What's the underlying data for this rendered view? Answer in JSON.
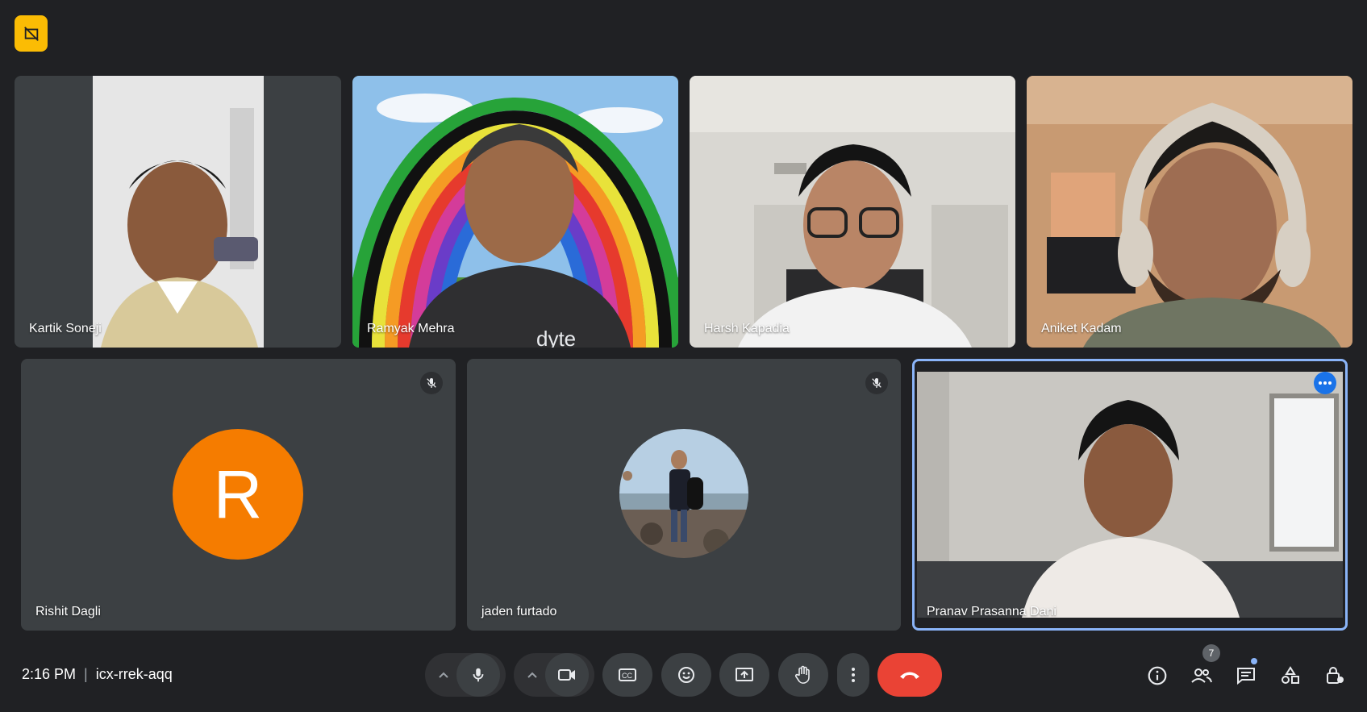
{
  "meeting": {
    "time": "2:16 PM",
    "code": "icx-rrek-aqq",
    "participant_count": "7"
  },
  "participants": [
    {
      "name": "Kartik Soneji"
    },
    {
      "name": "Ramyak Mehra",
      "shirt_text": "dyte"
    },
    {
      "name": "Harsh Kapadia"
    },
    {
      "name": "Aniket Kadam"
    },
    {
      "name": "Rishit Dagli",
      "initial": "R",
      "avatar_color": "#f57c00",
      "muted": true
    },
    {
      "name": "jaden furtado",
      "muted": true
    },
    {
      "name": "Pranav Prasanna Dani",
      "active_speaker": true
    }
  ],
  "colors": {
    "background": "#202124",
    "tile": "#3c4043",
    "hangup": "#ea4335",
    "highlight": "#8ab4f8",
    "badge": "#fbbc04"
  },
  "controls": [
    "mic-options",
    "mic",
    "camera-options",
    "camera",
    "captions",
    "reactions",
    "present-screen",
    "raise-hand",
    "more-options",
    "leave-call"
  ],
  "side_controls": [
    "meeting-details",
    "people",
    "chat",
    "activities",
    "host-controls"
  ]
}
